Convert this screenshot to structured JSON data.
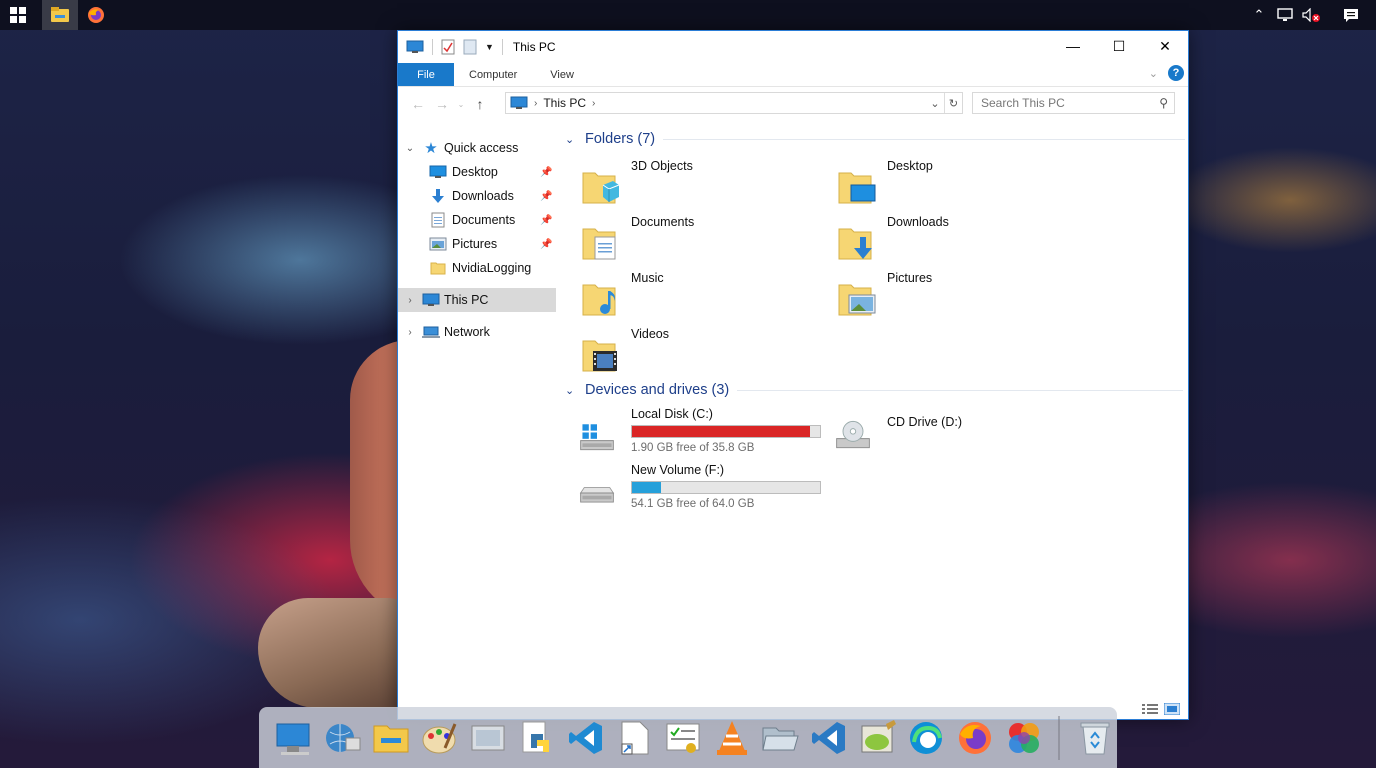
{
  "window": {
    "title": "This PC",
    "tabs": [
      "File",
      "Computer",
      "View"
    ]
  },
  "address": {
    "location": "This PC"
  },
  "search": {
    "placeholder": "Search This PC"
  },
  "navpane": {
    "quick_access": "Quick access",
    "items": [
      {
        "label": "Desktop",
        "icon": "desktop-icon",
        "pinned": true
      },
      {
        "label": "Downloads",
        "icon": "downloads-icon",
        "pinned": true
      },
      {
        "label": "Documents",
        "icon": "documents-icon",
        "pinned": true
      },
      {
        "label": "Pictures",
        "icon": "pictures-icon",
        "pinned": true
      },
      {
        "label": "NvidiaLogging",
        "icon": "folder-icon",
        "pinned": false
      }
    ],
    "this_pc": "This PC",
    "network": "Network"
  },
  "folders": {
    "header": "Folders (7)",
    "items": [
      {
        "label": "3D Objects",
        "icon": "3d-objects-folder-icon"
      },
      {
        "label": "Desktop",
        "icon": "desktop-folder-icon"
      },
      {
        "label": "Documents",
        "icon": "documents-folder-icon"
      },
      {
        "label": "Downloads",
        "icon": "downloads-folder-icon"
      },
      {
        "label": "Music",
        "icon": "music-folder-icon"
      },
      {
        "label": "Pictures",
        "icon": "pictures-folder-icon"
      },
      {
        "label": "Videos",
        "icon": "videos-folder-icon"
      }
    ]
  },
  "drives": {
    "header": "Devices and drives (3)",
    "items": [
      {
        "label": "Local Disk (C:)",
        "free": "1.90 GB free of 35.8 GB",
        "used_fraction": 0.947,
        "bar_color": "#da2626"
      },
      {
        "label": "CD Drive (D:)"
      },
      {
        "label": "New Volume (F:)",
        "free": "54.1 GB free of 64.0 GB",
        "used_fraction": 0.155,
        "bar_color": "#26a0da"
      }
    ]
  },
  "dock": {
    "apps": [
      "this-pc-icon",
      "network-globe-icon",
      "file-explorer-icon",
      "paint-icon",
      "gallery-icon",
      "python-icon",
      "vscode-icon",
      "shortcut-file-icon",
      "certificate-icon",
      "vlc-icon",
      "folder-open-icon",
      "vscode-insiders-icon",
      "notepad-plus-plus-icon",
      "edge-icon",
      "firefox-icon",
      "photos-icon",
      "recycle-bin-icon"
    ]
  },
  "colors": {
    "accent": "#1979ca",
    "header_blue": "#1e3f8a",
    "drive_full": "#da2626",
    "drive_ok": "#26a0da"
  }
}
